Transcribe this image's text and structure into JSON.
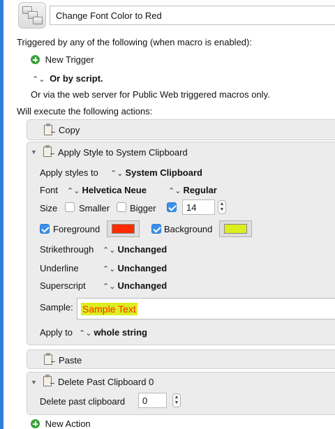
{
  "macro": {
    "name": "Change Font Color to Red"
  },
  "triggers": {
    "heading": "Triggered by any of the following (when macro is enabled):",
    "new_trigger_label": "New Trigger",
    "script_option": "Or by script.",
    "web_server_text": "Or via the web server for Public Web triggered macros only."
  },
  "actions_heading": "Will execute the following actions:",
  "actions": {
    "copy": {
      "title": "Copy"
    },
    "apply_style": {
      "title": "Apply Style to System Clipboard",
      "apply_styles_to_label": "Apply styles to",
      "apply_styles_to_value": "System Clipboard",
      "font_label": "Font",
      "font_family": "Helvetica Neue",
      "font_style": "Regular",
      "size_label": "Size",
      "smaller_label": "Smaller",
      "smaller_checked": false,
      "bigger_label": "Bigger",
      "bigger_checked": false,
      "size_checked": true,
      "size_value": "14",
      "foreground_label": "Foreground",
      "foreground_checked": true,
      "foreground_color": "#ff2a00",
      "background_label": "Background",
      "background_checked": true,
      "background_color": "#dcef1e",
      "strikethrough_label": "Strikethrough",
      "strikethrough_value": "Unchanged",
      "underline_label": "Underline",
      "underline_value": "Unchanged",
      "superscript_label": "Superscript",
      "superscript_value": "Unchanged",
      "sample_label": "Sample:",
      "sample_text": "Sample Text",
      "apply_to_label": "Apply to",
      "apply_to_value": "whole string"
    },
    "paste": {
      "title": "Paste"
    },
    "delete_past": {
      "title": "Delete Past Clipboard 0",
      "field_label": "Delete past clipboard",
      "field_value": "0"
    }
  },
  "new_action_label": "New Action",
  "colors": {
    "accent": "#2f7fd6",
    "checkbox_on": "#3b8fea",
    "plus_green": "#3aa13a",
    "panel_bg": "#ececec"
  },
  "icons": {
    "macro": "macro-icon",
    "plus": "plus-circle-icon",
    "clipboard": "clipboard-icon",
    "disclosure": "disclosure-triangle-icon",
    "updown": "updown-chevron-icon"
  }
}
